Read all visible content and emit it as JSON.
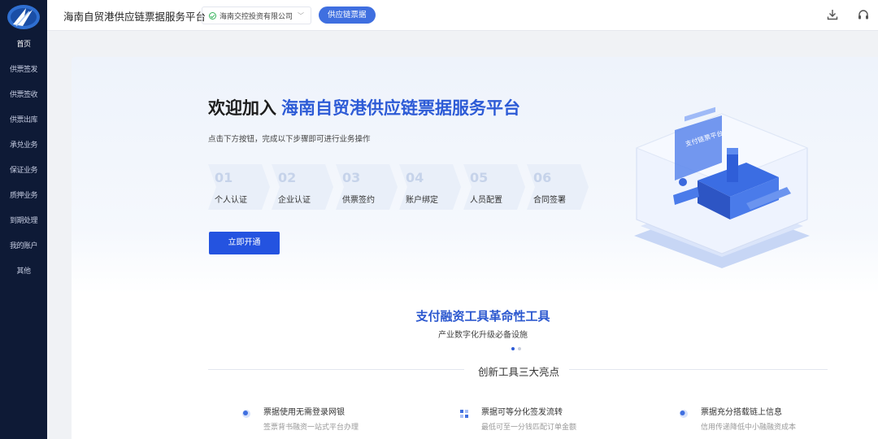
{
  "sidebar": {
    "items": [
      {
        "label": "首页"
      },
      {
        "label": "供票签发"
      },
      {
        "label": "供票签收"
      },
      {
        "label": "供票出库"
      },
      {
        "label": "承兑业务"
      },
      {
        "label": "保证业务"
      },
      {
        "label": "质押业务"
      },
      {
        "label": "到期处理"
      },
      {
        "label": "我的账户"
      },
      {
        "label": "其他"
      }
    ]
  },
  "header": {
    "app_title": "海南自贸港供应链票据服务平台",
    "company": "海南交控投资有限公司",
    "chain_button": "供应链票据",
    "icons": [
      "download-icon",
      "headset-icon"
    ]
  },
  "welcome": {
    "prefix": "欢迎加入",
    "highlight": "海南自贸港供应链票据服务平台",
    "subtitle": "点击下方按钮，完成以下步骤即可进行业务操作",
    "steps": [
      {
        "num": "01",
        "label": "个人认证"
      },
      {
        "num": "02",
        "label": "企业认证"
      },
      {
        "num": "03",
        "label": "供票签约"
      },
      {
        "num": "04",
        "label": "账户绑定"
      },
      {
        "num": "05",
        "label": "人员配置"
      },
      {
        "num": "06",
        "label": "合同签署"
      }
    ],
    "open_button": "立即开通",
    "illustration_label": "支付链票平台"
  },
  "promo": {
    "title": "支付融资工具革命性工具",
    "subtitle": "产业数字化升级必备设施",
    "carousel_active": 1,
    "carousel_total": 2
  },
  "highlights": {
    "title": "创新工具三大亮点",
    "items": [
      {
        "title": "票据使用无需登录网银",
        "desc": "签票背书融资一站式平台办理"
      },
      {
        "title": "票据可等分化签发流转",
        "desc": "最低可至一分钱匹配订单金额"
      },
      {
        "title": "票据充分搭载链上信息",
        "desc": "信用传递降低中小融融资成本"
      }
    ]
  },
  "colors": {
    "sidebar_bg": "#0e1a36",
    "accent": "#2453e0",
    "highlight_text": "#2d5bd6",
    "chain_button": "#3f6fe0"
  }
}
